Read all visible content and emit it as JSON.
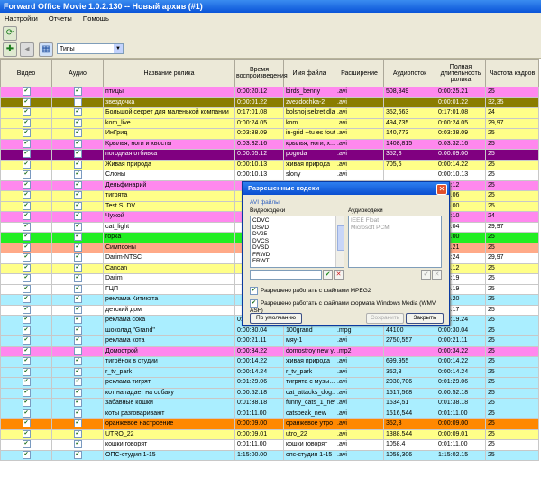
{
  "window": {
    "title": "Forward Office Movie 1.0.2.130 -- Новый архив (#1)"
  },
  "menu": [
    "Настройки",
    "Отчеты",
    "Помощь"
  ],
  "toolbar": {
    "filter_value": "Типы"
  },
  "table": {
    "columns": [
      "Видео",
      "Аудио",
      "Название ролика",
      "Время воспроизведения",
      "Имя файла",
      "Расширение",
      "Аудиопоток",
      "Полная длительность ролика",
      "Частота кадров"
    ],
    "rows": [
      {
        "v": true,
        "a": true,
        "name": "птицы",
        "time": "0:00:20.12",
        "file": "birds_benny",
        "ext": ".avi",
        "audio": "508,849",
        "full": "0:00:25.21",
        "fps": "25",
        "bg": "#ff88ee"
      },
      {
        "v": true,
        "a": false,
        "name": "звездочка",
        "time": "0:00:01.22",
        "file": "zvezdochka-2",
        "ext": ".avi",
        "audio": "",
        "full": "0:00:01.22",
        "fps": "32,35",
        "bg": "#8a7d00",
        "fg": "#ffffff"
      },
      {
        "v": true,
        "a": true,
        "name": "Большой секрет для маленькой компании",
        "time": "0:17:01.08",
        "file": "bolshoj sekret dla...",
        "ext": ".avi",
        "audio": "352,663",
        "full": "0:17:01.08",
        "fps": "24",
        "bg": "#ffff88"
      },
      {
        "v": true,
        "a": true,
        "name": "kom_live",
        "time": "0:00:24.05",
        "file": "kom",
        "ext": ".avi",
        "audio": "494,735",
        "full": "0:00:24.05",
        "fps": "29,97",
        "bg": "#ffff88"
      },
      {
        "v": true,
        "a": true,
        "name": "ИнГрид",
        "time": "0:03:38.09",
        "file": "in-grid --tu es foutu",
        "ext": ".avi",
        "audio": "140,773",
        "full": "0:03:38.09",
        "fps": "25",
        "bg": "#ffff88"
      },
      {
        "v": true,
        "a": true,
        "name": "Крылья, ноги и хвосты",
        "time": "0:03:32.16",
        "file": "крылья, ноги, х...",
        "ext": ".avi",
        "audio": "1408,815",
        "full": "0:03:32.16",
        "fps": "25",
        "bg": "#ff88ee"
      },
      {
        "v": true,
        "a": true,
        "name": "погодная отбивка",
        "time": "0:00:05.12",
        "file": "pogoda",
        "ext": ".avi",
        "audio": "352,8",
        "full": "0:00:09.00",
        "fps": "25",
        "bg": "#800080",
        "fg": "#ffffff"
      },
      {
        "v": true,
        "a": true,
        "name": "Живая природа",
        "time": "0:00:10.13",
        "file": "живая природа",
        "ext": ".avi",
        "audio": "705,6",
        "full": "0:00:14.22",
        "fps": "25",
        "bg": "#ffff88"
      },
      {
        "v": true,
        "a": true,
        "name": "Слоны",
        "time": "0:00:10.13",
        "file": "slony",
        "ext": ".avi",
        "audio": "",
        "full": "0:00:10.13",
        "fps": "25",
        "bg": "#ffffff"
      },
      {
        "v": true,
        "a": true,
        "name": "Дельфинарий",
        "time": "",
        "file": "",
        "ext": "",
        "audio": "",
        "full": "0:01:12",
        "fps": "25",
        "bg": "#ff88ee"
      },
      {
        "v": true,
        "a": true,
        "name": "тигрята",
        "time": "",
        "file": "",
        "ext": "",
        "audio": "",
        "full": "0:29.06",
        "fps": "25",
        "bg": "#ffff88"
      },
      {
        "v": true,
        "a": true,
        "name": "Test SLDV",
        "time": "",
        "file": "",
        "ext": "",
        "audio": "",
        "full": "0:05.00",
        "fps": "25",
        "bg": "#ffff88"
      },
      {
        "v": true,
        "a": true,
        "name": "Чужой",
        "time": "",
        "file": "",
        "ext": "",
        "audio": "",
        "full": "0:42:10",
        "fps": "24",
        "bg": "#ff88ee"
      },
      {
        "v": true,
        "a": true,
        "name": "cat_light",
        "time": "",
        "file": "",
        "ext": "",
        "audio": "",
        "full": "0:10.04",
        "fps": "29,97",
        "bg": "#ffffff"
      },
      {
        "v": true,
        "a": true,
        "name": "горка",
        "time": "",
        "file": "",
        "ext": "",
        "audio": "",
        "full": "0:09.00",
        "fps": "25",
        "bg": "#22ee22"
      },
      {
        "v": true,
        "a": true,
        "name": "Симпсоны",
        "time": "",
        "file": "",
        "ext": "",
        "audio": "",
        "full": "0:12.21",
        "fps": "25",
        "bg": "#ffaa88"
      },
      {
        "v": true,
        "a": true,
        "name": "Darim-NTSC",
        "time": "",
        "file": "",
        "ext": "",
        "audio": "",
        "full": "0:53:24",
        "fps": "29,97",
        "bg": "#ffffff"
      },
      {
        "v": true,
        "a": true,
        "name": "Cancan",
        "time": "",
        "file": "",
        "ext": "",
        "audio": "",
        "full": "0:38.12",
        "fps": "25",
        "bg": "#ffff88"
      },
      {
        "v": true,
        "a": true,
        "name": "Darim",
        "time": "",
        "file": "",
        "ext": "",
        "audio": "",
        "full": "0:53:19",
        "fps": "25",
        "bg": "#ffffff"
      },
      {
        "v": true,
        "a": true,
        "name": "ГЦП",
        "time": "",
        "file": "",
        "ext": "",
        "audio": "",
        "full": "0:00.19",
        "fps": "25",
        "bg": "#ffffff"
      },
      {
        "v": true,
        "a": true,
        "name": "реклама Китикэта",
        "time": "",
        "file": "",
        "ext": "",
        "audio": "",
        "full": "0:00.20",
        "fps": "25",
        "bg": "#aaeeff"
      },
      {
        "v": true,
        "a": true,
        "name": "детский дом",
        "time": "",
        "file": "",
        "ext": "",
        "audio": "",
        "full": "0:33:17",
        "fps": "25",
        "bg": "#ffffff"
      },
      {
        "v": true,
        "a": true,
        "name": "реклама сока",
        "time": "0:00:19.24",
        "file": "r_sok_yastsad",
        "ext": ".avi",
        "audio": "704,189",
        "full": "0:00:19.24",
        "fps": "25",
        "bg": "#aaeeff"
      },
      {
        "v": true,
        "a": true,
        "name": "шоколад \"Grand\"",
        "time": "0:00:30.04",
        "file": "100grand",
        "ext": ".mpg",
        "audio": "44100",
        "full": "0:00:30.04",
        "fps": "25",
        "bg": "#aaeeff"
      },
      {
        "v": true,
        "a": true,
        "name": "реклама кота",
        "time": "0:00:21.11",
        "file": "мяу-1",
        "ext": ".avi",
        "audio": "2750,557",
        "full": "0:00:21.11",
        "fps": "25",
        "bg": "#aaeeff"
      },
      {
        "v": true,
        "a": false,
        "name": "Домострой",
        "time": "0:00:34.22",
        "file": "domostroy new y...",
        "ext": ".mp2",
        "audio": "",
        "full": "0:00:34.22",
        "fps": "25",
        "bg": "#ff88ee"
      },
      {
        "v": true,
        "a": true,
        "name": "тигрёнок в студии",
        "time": "0:00:14.22",
        "file": "живая природа",
        "ext": ".avi",
        "audio": "699,955",
        "full": "0:00:14.22",
        "fps": "25",
        "bg": "#aaeeff"
      },
      {
        "v": true,
        "a": true,
        "name": "r_tv_park",
        "time": "0:00:14.24",
        "file": "r_tv_park",
        "ext": ".avi",
        "audio": "352,8",
        "full": "0:00:14.24",
        "fps": "25",
        "bg": "#aaeeff"
      },
      {
        "v": true,
        "a": true,
        "name": "реклама тигрят",
        "time": "0:01:29.06",
        "file": "тигрята с музы...",
        "ext": ".avi",
        "audio": "2030,706",
        "full": "0:01:29.06",
        "fps": "25",
        "bg": "#aaeeff"
      },
      {
        "v": true,
        "a": true,
        "name": "кот нападает на собаку",
        "time": "0:00:52.18",
        "file": "cat_attacks_dog...",
        "ext": ".avi",
        "audio": "1517,568",
        "full": "0:00:52.18",
        "fps": "25",
        "bg": "#aaeeff"
      },
      {
        "v": true,
        "a": true,
        "name": "забавные кошки",
        "time": "0:01:38.18",
        "file": "funny_cats_1_new",
        "ext": ".avi",
        "audio": "1534,51",
        "full": "0:01:38.18",
        "fps": "25",
        "bg": "#aaeeff"
      },
      {
        "v": true,
        "a": true,
        "name": "коты разговаривают",
        "time": "0:01:11.00",
        "file": "catspeak_new",
        "ext": ".avi",
        "audio": "1516,544",
        "full": "0:01:11.00",
        "fps": "25",
        "bg": "#aaeeff"
      },
      {
        "v": true,
        "a": true,
        "name": "оранжевое настроение",
        "time": "0:00:09.00",
        "file": "оранжевое утро",
        "ext": ".avi",
        "audio": "352,8",
        "full": "0:00:09.00",
        "fps": "25",
        "bg": "#ff8800"
      },
      {
        "v": true,
        "a": true,
        "name": "UTRO_22",
        "time": "0:00:09.01",
        "file": "utro_22",
        "ext": ".avi",
        "audio": "1388,544",
        "full": "0:00:09.01",
        "fps": "25",
        "bg": "#ffff88"
      },
      {
        "v": true,
        "a": true,
        "name": "кошки говорят",
        "time": "0:01:11.00",
        "file": "кошки говорят",
        "ext": ".avi",
        "audio": "1058,4",
        "full": "0:01:11.00",
        "fps": "25",
        "bg": "#ffffff"
      },
      {
        "v": true,
        "a": true,
        "name": "ОПС-студия 1-15",
        "time": "1:15:00.00",
        "file": "опс-студия 1-15",
        "ext": ".avi",
        "audio": "1058,306",
        "full": "1:15:02.15",
        "fps": "25",
        "bg": "#aaeeff"
      }
    ]
  },
  "dialog": {
    "title": "Разрешенные кодеки",
    "tab": "AVI файлы",
    "video_label": "Видеокодеки",
    "audio_label": "Аудиокодеки",
    "video_codecs": [
      "CDVC",
      "DSVD",
      "DV25",
      "DVCS",
      "DVSD",
      "FRWD",
      "FRWT"
    ],
    "audio_codecs": [
      "IEEE Float",
      "Microsoft PCM"
    ],
    "mpeg2_label": "Разрешено работать с файлами MPEG2",
    "wmv_label": "Разрешено работать с файлами формата Windows Media (WMV, ASF)",
    "default_btn": "По умолчанию",
    "save_btn": "Сохранить",
    "close_btn": "Закрыть"
  }
}
